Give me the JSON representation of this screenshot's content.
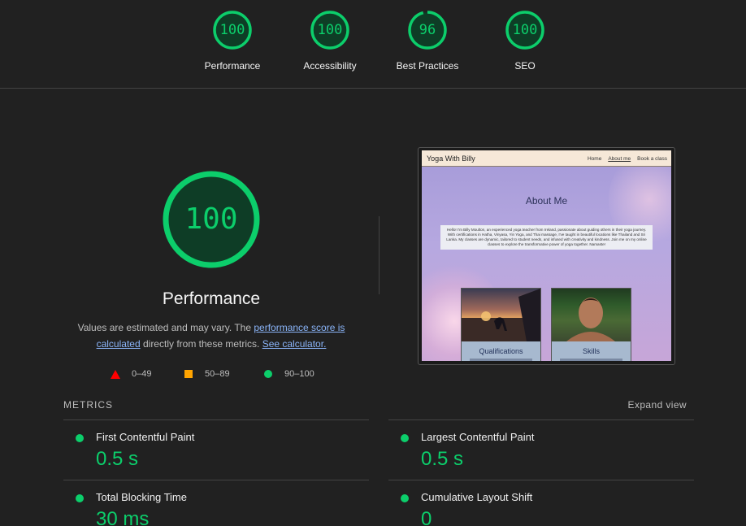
{
  "summary_gauges": [
    {
      "score": "100",
      "label": "Performance",
      "fraction": 1.0
    },
    {
      "score": "100",
      "label": "Accessibility",
      "fraction": 1.0
    },
    {
      "score": "96",
      "label": "Best Practices",
      "fraction": 0.96
    },
    {
      "score": "100",
      "label": "SEO",
      "fraction": 1.0
    }
  ],
  "performance": {
    "score": "100",
    "fraction": 1.0,
    "title": "Performance",
    "desc_prefix": "Values are estimated and may vary. The ",
    "desc_link1": "performance score is calculated",
    "desc_middle": " directly from these metrics. ",
    "desc_link2": "See calculator."
  },
  "legend": {
    "fail": "0–49",
    "average": "50–89",
    "pass": "90–100"
  },
  "screenshot": {
    "brand": "Yoga With Billy",
    "nav_home": "Home",
    "nav_about": "About me",
    "nav_book": "Book a class",
    "heading": "About Me",
    "intro": "Hello! I'm Billy Moulton, an experienced yoga teacher from Ireland, passionate about guiding others in their yoga journey. With certifications in Hatha, Vinyasa, Yin Yoga, and Thai massage, I've taught in beautiful locations like Thailand and Sri Lanka. My classes are dynamic, tailored to student needs, and infused with creativity and kindness. Join me on my online classes to explore the transformative power of yoga together. Namaste!",
    "card1_title": "Qualifications",
    "card2_title": "Skills"
  },
  "metrics": {
    "header": "METRICS",
    "expand_label": "Expand view",
    "items": [
      {
        "name": "First Contentful Paint",
        "value": "0.5 s"
      },
      {
        "name": "Largest Contentful Paint",
        "value": "0.5 s"
      },
      {
        "name": "Total Blocking Time",
        "value": "30 ms"
      },
      {
        "name": "Cumulative Layout Shift",
        "value": "0"
      }
    ]
  },
  "colors": {
    "pass": "#0cce6b",
    "average": "#ffa400",
    "fail": "#ff0000",
    "background": "#212121"
  }
}
